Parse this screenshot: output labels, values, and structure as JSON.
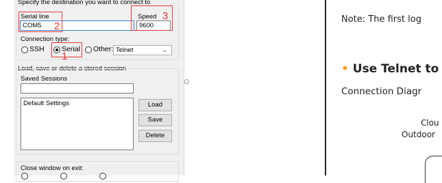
{
  "left": {
    "destination_label": "Specify the destination you want to connect to",
    "serial_line_label": "Serial line",
    "serial_line_value": "COM5",
    "speed_label": "Speed",
    "speed_value": "9600",
    "connection_type_label": "Connection type:",
    "radios": [
      "SSH",
      "Serial",
      "Other:"
    ],
    "other_combo_value": "Telnet",
    "session_group_label": "Load, save or delete a stored session",
    "saved_sessions_label": "Saved Sessions",
    "saved_sessions_value": "",
    "sessions": [
      "Default Settings"
    ],
    "buttons": {
      "load": "Load",
      "save": "Save",
      "delete": "Delete"
    },
    "close_window_label": "Close window on exit:",
    "annotations": [
      "1",
      "2",
      "3"
    ],
    "annotation_color": "#e53935"
  },
  "right": {
    "note": "Note: The first log",
    "heading_bullet": "•",
    "heading": "Use Telnet to",
    "subheading": "Connection Diagr",
    "diagram_line1": "Clou",
    "diagram_line2": "Outdoor",
    "bullet_color": "#f5a623"
  }
}
